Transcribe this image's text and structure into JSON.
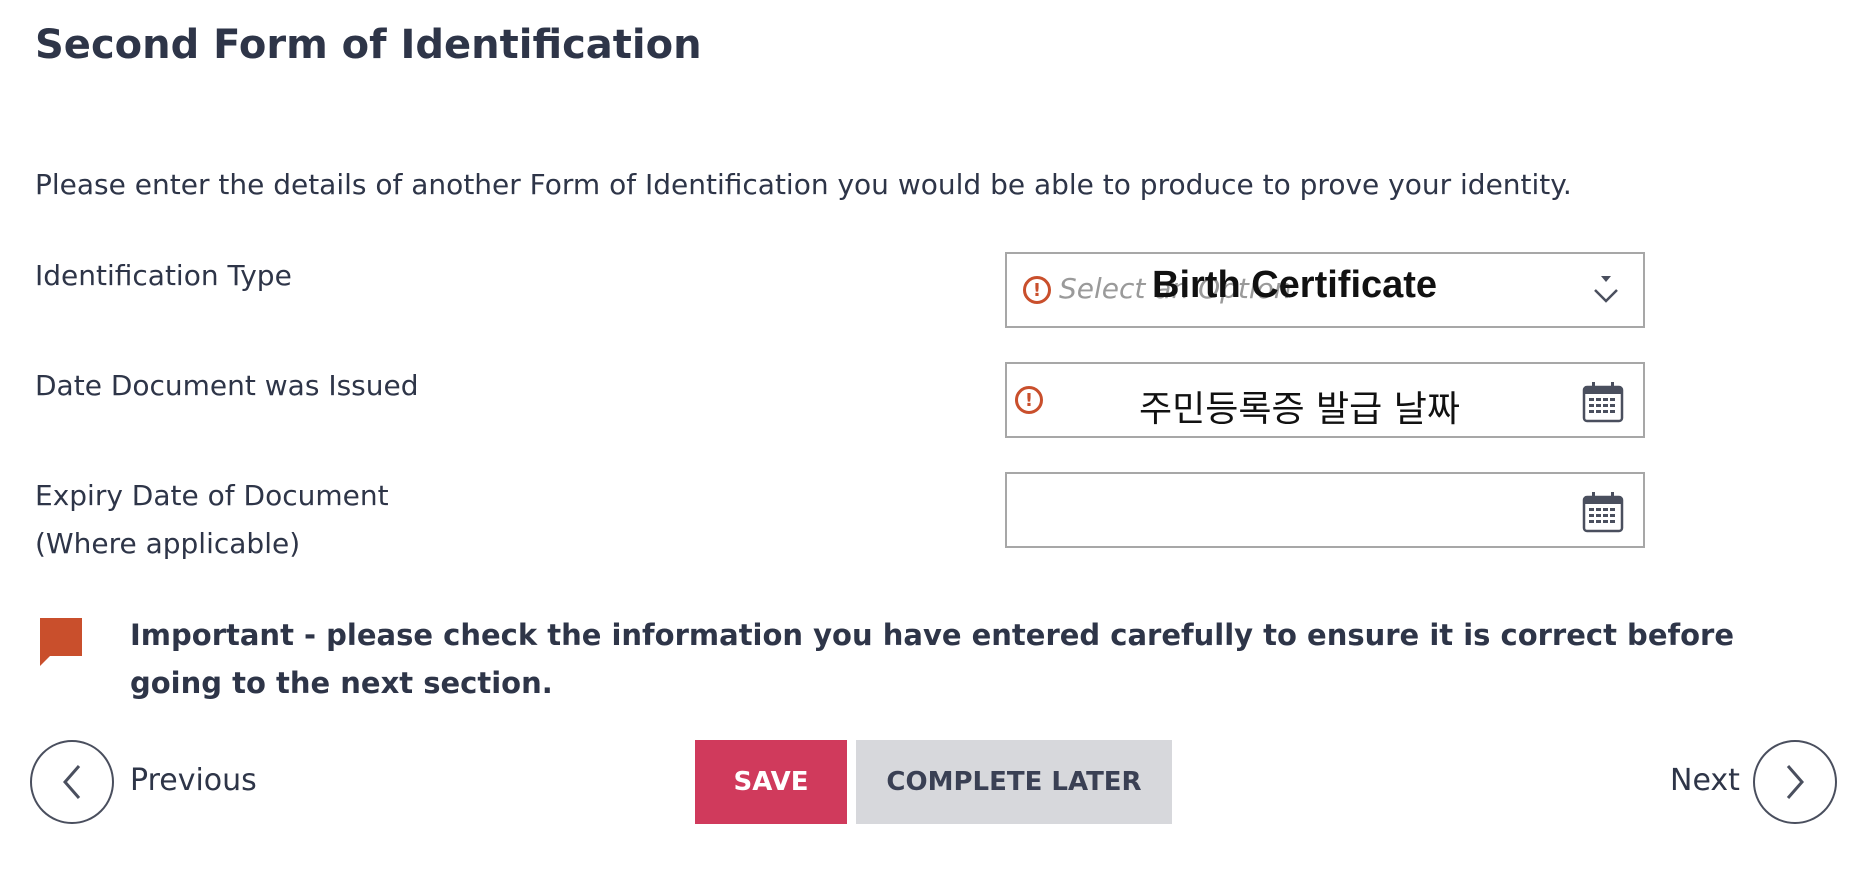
{
  "page": {
    "title": "Second Form of Identification",
    "intro": "Please enter the details of another Form of Identification you would be able to produce to prove your identity."
  },
  "fields": {
    "identification_type": {
      "label": "Identification Type",
      "placeholder": "Select an Option",
      "value": "Birth Certificate",
      "error_icon": "!"
    },
    "date_issued": {
      "label": "Date Document was Issued",
      "value": "주민등록증 발급 날짜",
      "error_icon": "!"
    },
    "expiry_date": {
      "label_line1": "Expiry Date of Document",
      "label_line2": "(Where applicable)",
      "value": ""
    }
  },
  "warning": {
    "text": "Important - please check the information you have entered carefully to ensure it is correct before going to the next section."
  },
  "navigation": {
    "previous_label": "Previous",
    "next_label": "Next",
    "save_label": "SAVE",
    "complete_later_label": "COMPLETE LATER"
  },
  "colors": {
    "text": "#2e3548",
    "error": "#c94f2c",
    "save_button": "#d03a5c",
    "complete_later_button": "#d7d8dc",
    "field_border": "#a7a7a7"
  }
}
